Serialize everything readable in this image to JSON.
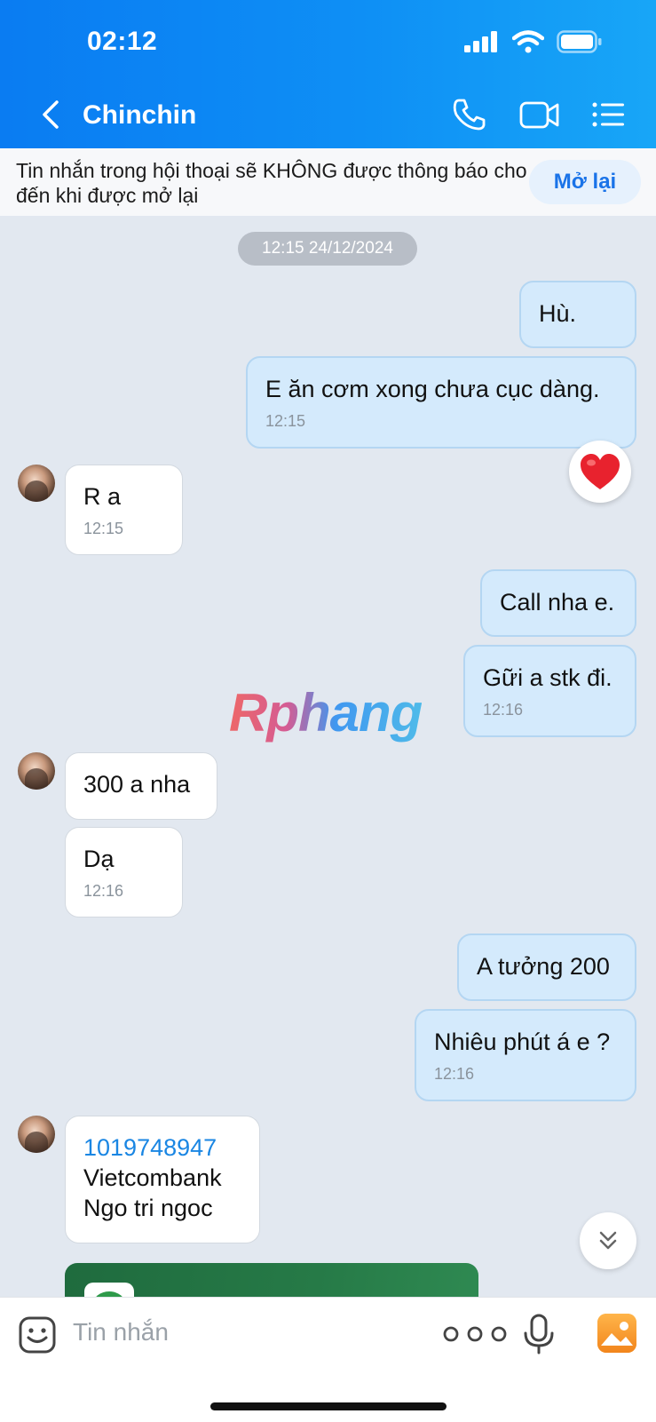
{
  "status_bar": {
    "time": "02:12"
  },
  "header": {
    "title": "Chinchin"
  },
  "notice": {
    "text": "Tin nhắn trong hội thoại sẽ KHÔNG được thông báo cho đến khi được mở lại",
    "button": "Mở lại"
  },
  "chat": {
    "date_divider": "12:15 24/12/2024",
    "messages": [
      {
        "side": "out",
        "text": "Hù.",
        "time": ""
      },
      {
        "side": "out",
        "text": "E ăn cơm xong chưa cục dàng.",
        "time": "12:15"
      },
      {
        "side": "in",
        "text": "R a",
        "time": "12:15"
      },
      {
        "side": "out",
        "text": "Call nha e.",
        "time": ""
      },
      {
        "side": "out",
        "text": "Gữi a stk đi.",
        "time": "12:16"
      },
      {
        "side": "in",
        "text": "300 a nha",
        "time": ""
      },
      {
        "side": "in",
        "text": "Dạ",
        "time": "12:16"
      },
      {
        "side": "out",
        "text": "A tưởng 200",
        "time": ""
      },
      {
        "side": "out",
        "text": "Nhiêu phút á e ?",
        "time": "12:16"
      },
      {
        "side": "in",
        "lines": [
          "1019748947",
          "Vietcombank",
          "Ngo tri ngoc"
        ],
        "time": ""
      }
    ],
    "reaction": "heart"
  },
  "watermark": "Rphang",
  "input": {
    "placeholder": "Tin nhắn"
  },
  "icons": {
    "back": "chevron-left-icon",
    "call": "phone-icon",
    "video": "video-camera-icon",
    "menu": "list-icon",
    "emoji": "sticker-icon",
    "more": "more-dots-icon",
    "mic": "microphone-icon",
    "image": "image-icon",
    "scroll": "double-chevron-down-icon"
  },
  "colors": {
    "header": "#0a7cf2",
    "outgoing_bubble": "#d4eafc",
    "chat_bg": "#e2e8f0",
    "link": "#1a86e3"
  }
}
